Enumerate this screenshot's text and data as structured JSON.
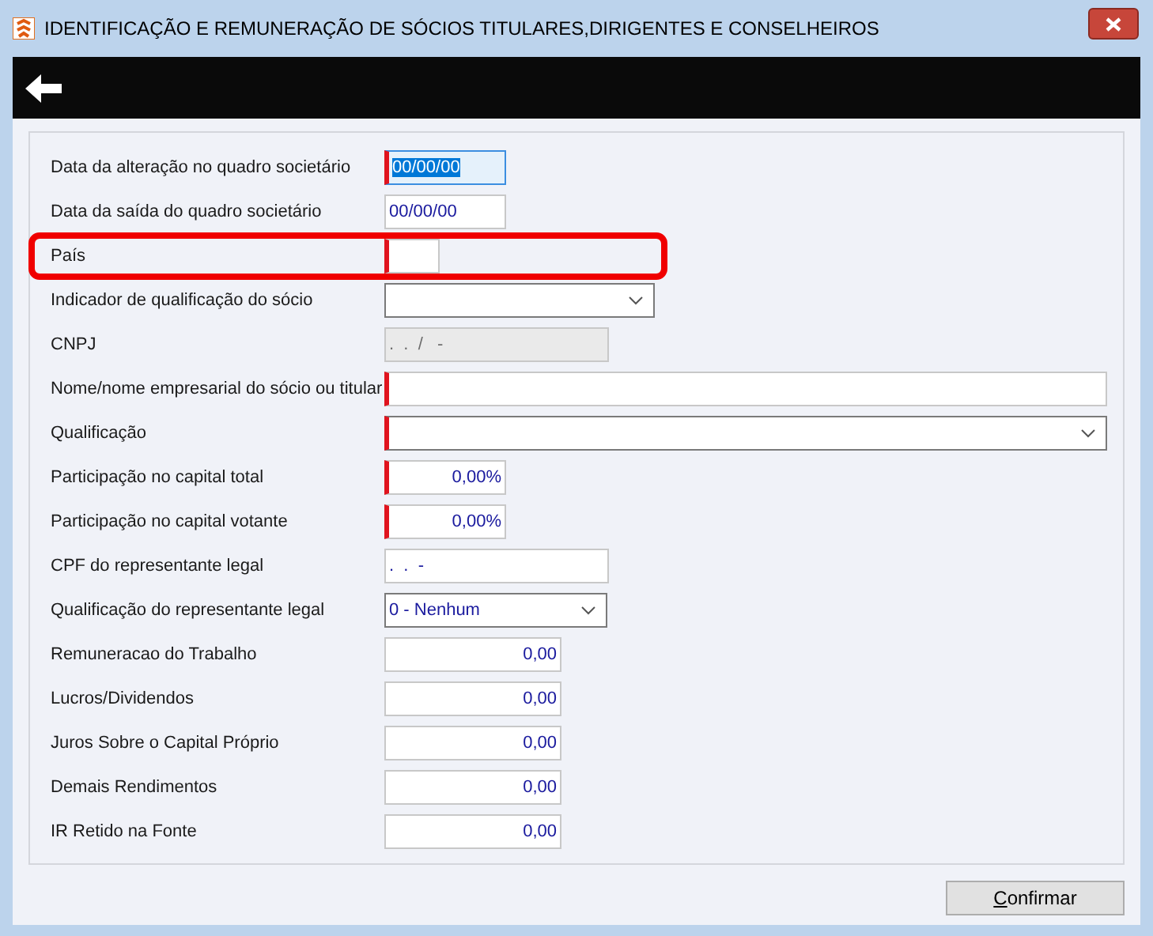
{
  "window": {
    "title": "IDENTIFICAÇÃO E REMUNERAÇÃO DE SÓCIOS TITULARES,DIRIGENTES E CONSELHEIROS"
  },
  "fields": [
    {
      "label": "Data da alteração no quadro societário",
      "kind": "date",
      "value": "00/00/00",
      "required": true,
      "focused": true,
      "disabled": false,
      "highlighted": false
    },
    {
      "label": "Data da saída do quadro societário",
      "kind": "date",
      "value": "00/00/00",
      "required": false,
      "focused": false,
      "disabled": false,
      "highlighted": false
    },
    {
      "label": "País",
      "kind": "code",
      "required": true,
      "focused": false,
      "disabled": false,
      "highlighted": true
    },
    {
      "label": "Indicador de qualificação do sócio",
      "kind": "combo",
      "required": false,
      "focused": false,
      "disabled": false,
      "highlighted": false
    },
    {
      "label": "CNPJ",
      "kind": "masked",
      "value": ".  .  /   -",
      "required": false,
      "focused": false,
      "disabled": true,
      "highlighted": false
    },
    {
      "label": "Nome/nome empresarial do sócio ou titular",
      "kind": "wide-text",
      "required": true,
      "focused": false,
      "disabled": false,
      "highlighted": false
    },
    {
      "label": "Qualificação",
      "kind": "wide-combo",
      "required": true,
      "focused": false,
      "disabled": false,
      "highlighted": false
    },
    {
      "label": "Participação no capital total",
      "kind": "percent",
      "value": "0,00%",
      "required": true,
      "focused": false,
      "disabled": false,
      "highlighted": false
    },
    {
      "label": "Participação no capital votante",
      "kind": "percent",
      "value": "0,00%",
      "required": true,
      "focused": false,
      "disabled": false,
      "highlighted": false
    },
    {
      "label": "CPF do representante legal",
      "kind": "masked",
      "value": ".  .  -",
      "required": false,
      "focused": false,
      "disabled": false,
      "highlighted": false
    },
    {
      "label": "Qualificação do representante legal",
      "kind": "small-combo",
      "value": "0 - Nenhum",
      "required": false,
      "focused": false,
      "disabled": false,
      "highlighted": false
    },
    {
      "label": "Remuneracao do Trabalho",
      "kind": "money",
      "value": "0,00",
      "required": false,
      "focused": false,
      "disabled": false,
      "highlighted": false
    },
    {
      "label": "Lucros/Dividendos",
      "kind": "money",
      "value": "0,00",
      "required": false,
      "focused": false,
      "disabled": false,
      "highlighted": false
    },
    {
      "label": "Juros Sobre o Capital Próprio",
      "kind": "money",
      "value": "0,00",
      "required": false,
      "focused": false,
      "disabled": false,
      "highlighted": false
    },
    {
      "label": "Demais Rendimentos",
      "kind": "money",
      "value": "0,00",
      "required": false,
      "focused": false,
      "disabled": false,
      "highlighted": false
    },
    {
      "label": "IR Retido na Fonte",
      "kind": "money",
      "value": "0,00",
      "required": false,
      "focused": false,
      "disabled": false,
      "highlighted": false
    }
  ],
  "buttons": [
    {
      "label": "Confirmar"
    }
  ]
}
